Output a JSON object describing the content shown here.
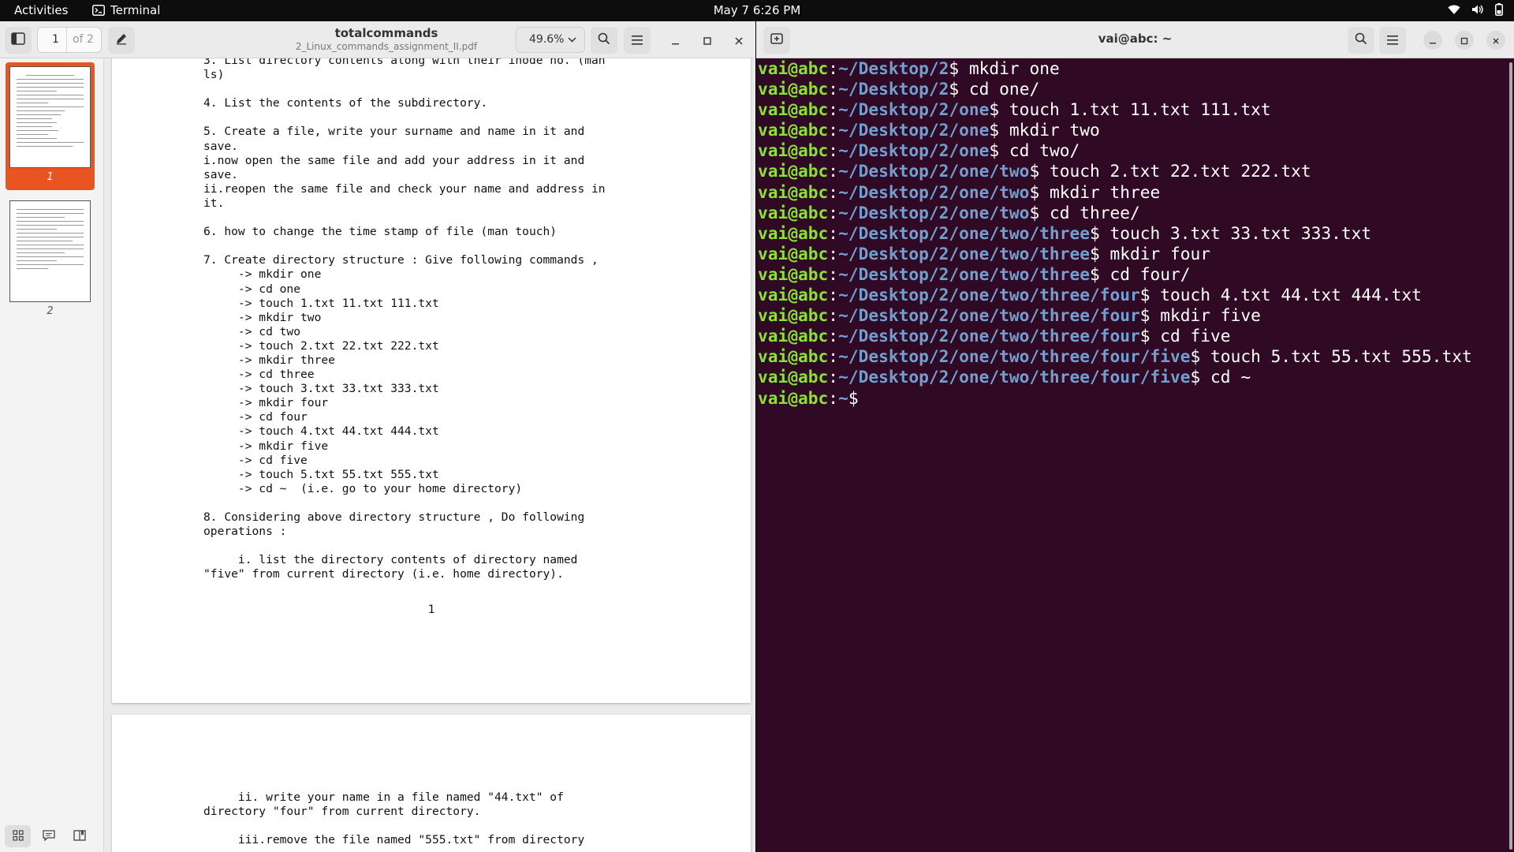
{
  "topbar": {
    "activities": "Activities",
    "app_name": "Terminal",
    "clock": "May 7  6:26 PM"
  },
  "viewer": {
    "title": "totalcommands",
    "subtitle": "2_Linux_commands_assignment_II.pdf",
    "page_current": "1",
    "page_total": "of 2",
    "zoom": "49.6%",
    "thumbs": [
      {
        "label": "1",
        "selected": true
      },
      {
        "label": "2",
        "selected": false
      }
    ],
    "page1_text": "3. List directory contents along with their inode no. (man\nls)\n\n4. List the contents of the subdirectory.\n\n5. Create a file, write your surname and name in it and\nsave.\ni.now open the same file and add your address in it and\nsave.\nii.reopen the same file and check your name and address in\nit.\n\n6. how to change the time stamp of file (man touch)\n\n7. Create directory structure : Give following commands ,\n     -> mkdir one\n     -> cd one\n     -> touch 1.txt 11.txt 111.txt\n     -> mkdir two\n     -> cd two\n     -> touch 2.txt 22.txt 222.txt\n     -> mkdir three\n     -> cd three\n     -> touch 3.txt 33.txt 333.txt\n     -> mkdir four\n     -> cd four\n     -> touch 4.txt 44.txt 444.txt\n     -> mkdir five\n     -> cd five\n     -> touch 5.txt 55.txt 555.txt\n     -> cd ~  (i.e. go to your home directory)\n\n8. Considering above directory structure , Do following\noperations :\n\n     i. list the directory contents of directory named\n\"five\" from current directory (i.e. home directory).",
    "page1_number": "1",
    "page2_text": "     ii. write your name in a file named \"44.txt\" of\ndirectory \"four\" from current directory.\n\n     iii.remove the file named \"555.txt\" from directory"
  },
  "terminal": {
    "title": "vai@abc: ~",
    "lines": [
      {
        "user": "vai@abc",
        "path": "~/Desktop/2",
        "cmd": " mkdir one"
      },
      {
        "user": "vai@abc",
        "path": "~/Desktop/2",
        "cmd": " cd one/"
      },
      {
        "user": "vai@abc",
        "path": "~/Desktop/2/one",
        "cmd": " touch 1.txt 11.txt 111.txt"
      },
      {
        "user": "vai@abc",
        "path": "~/Desktop/2/one",
        "cmd": " mkdir two"
      },
      {
        "user": "vai@abc",
        "path": "~/Desktop/2/one",
        "cmd": " cd two/"
      },
      {
        "user": "vai@abc",
        "path": "~/Desktop/2/one/two",
        "cmd": " touch 2.txt 22.txt 222.txt"
      },
      {
        "user": "vai@abc",
        "path": "~/Desktop/2/one/two",
        "cmd": " mkdir three"
      },
      {
        "user": "vai@abc",
        "path": "~/Desktop/2/one/two",
        "cmd": " cd three/"
      },
      {
        "user": "vai@abc",
        "path": "~/Desktop/2/one/two/three",
        "cmd": " touch 3.txt 33.txt 333.txt"
      },
      {
        "user": "vai@abc",
        "path": "~/Desktop/2/one/two/three",
        "cmd": " mkdir four"
      },
      {
        "user": "vai@abc",
        "path": "~/Desktop/2/one/two/three",
        "cmd": " cd four/"
      },
      {
        "user": "vai@abc",
        "path": "~/Desktop/2/one/two/three/four",
        "cmd": " touch 4.txt 44.txt 444.txt"
      },
      {
        "user": "vai@abc",
        "path": "~/Desktop/2/one/two/three/four",
        "cmd": " mkdir five"
      },
      {
        "user": "vai@abc",
        "path": "~/Desktop/2/one/two/three/four",
        "cmd": " cd five"
      },
      {
        "user": "vai@abc",
        "path": "~/Desktop/2/one/two/three/four/five",
        "cmd": " touch 5.txt 55.txt 555.txt"
      },
      {
        "user": "vai@abc",
        "path": "~/Desktop/2/one/two/three/four/five",
        "cmd": " cd ~"
      },
      {
        "user": "vai@abc",
        "path": "~",
        "cmd": ""
      }
    ],
    "colors": {
      "background": "#300a24",
      "user": "#8ae234",
      "path": "#729fcf",
      "text": "#ffffff"
    }
  },
  "icons": [
    "terminal-icon",
    "sidebar-toggle-icon",
    "annotate-pen-icon",
    "chevron-down-icon",
    "search-icon",
    "menu-icon",
    "minimize-icon",
    "maximize-icon",
    "close-icon",
    "new-tab-icon",
    "wifi-icon",
    "volume-icon",
    "battery-icon",
    "thumbnails-icon",
    "annotations-icon",
    "bookmarks-icon"
  ]
}
